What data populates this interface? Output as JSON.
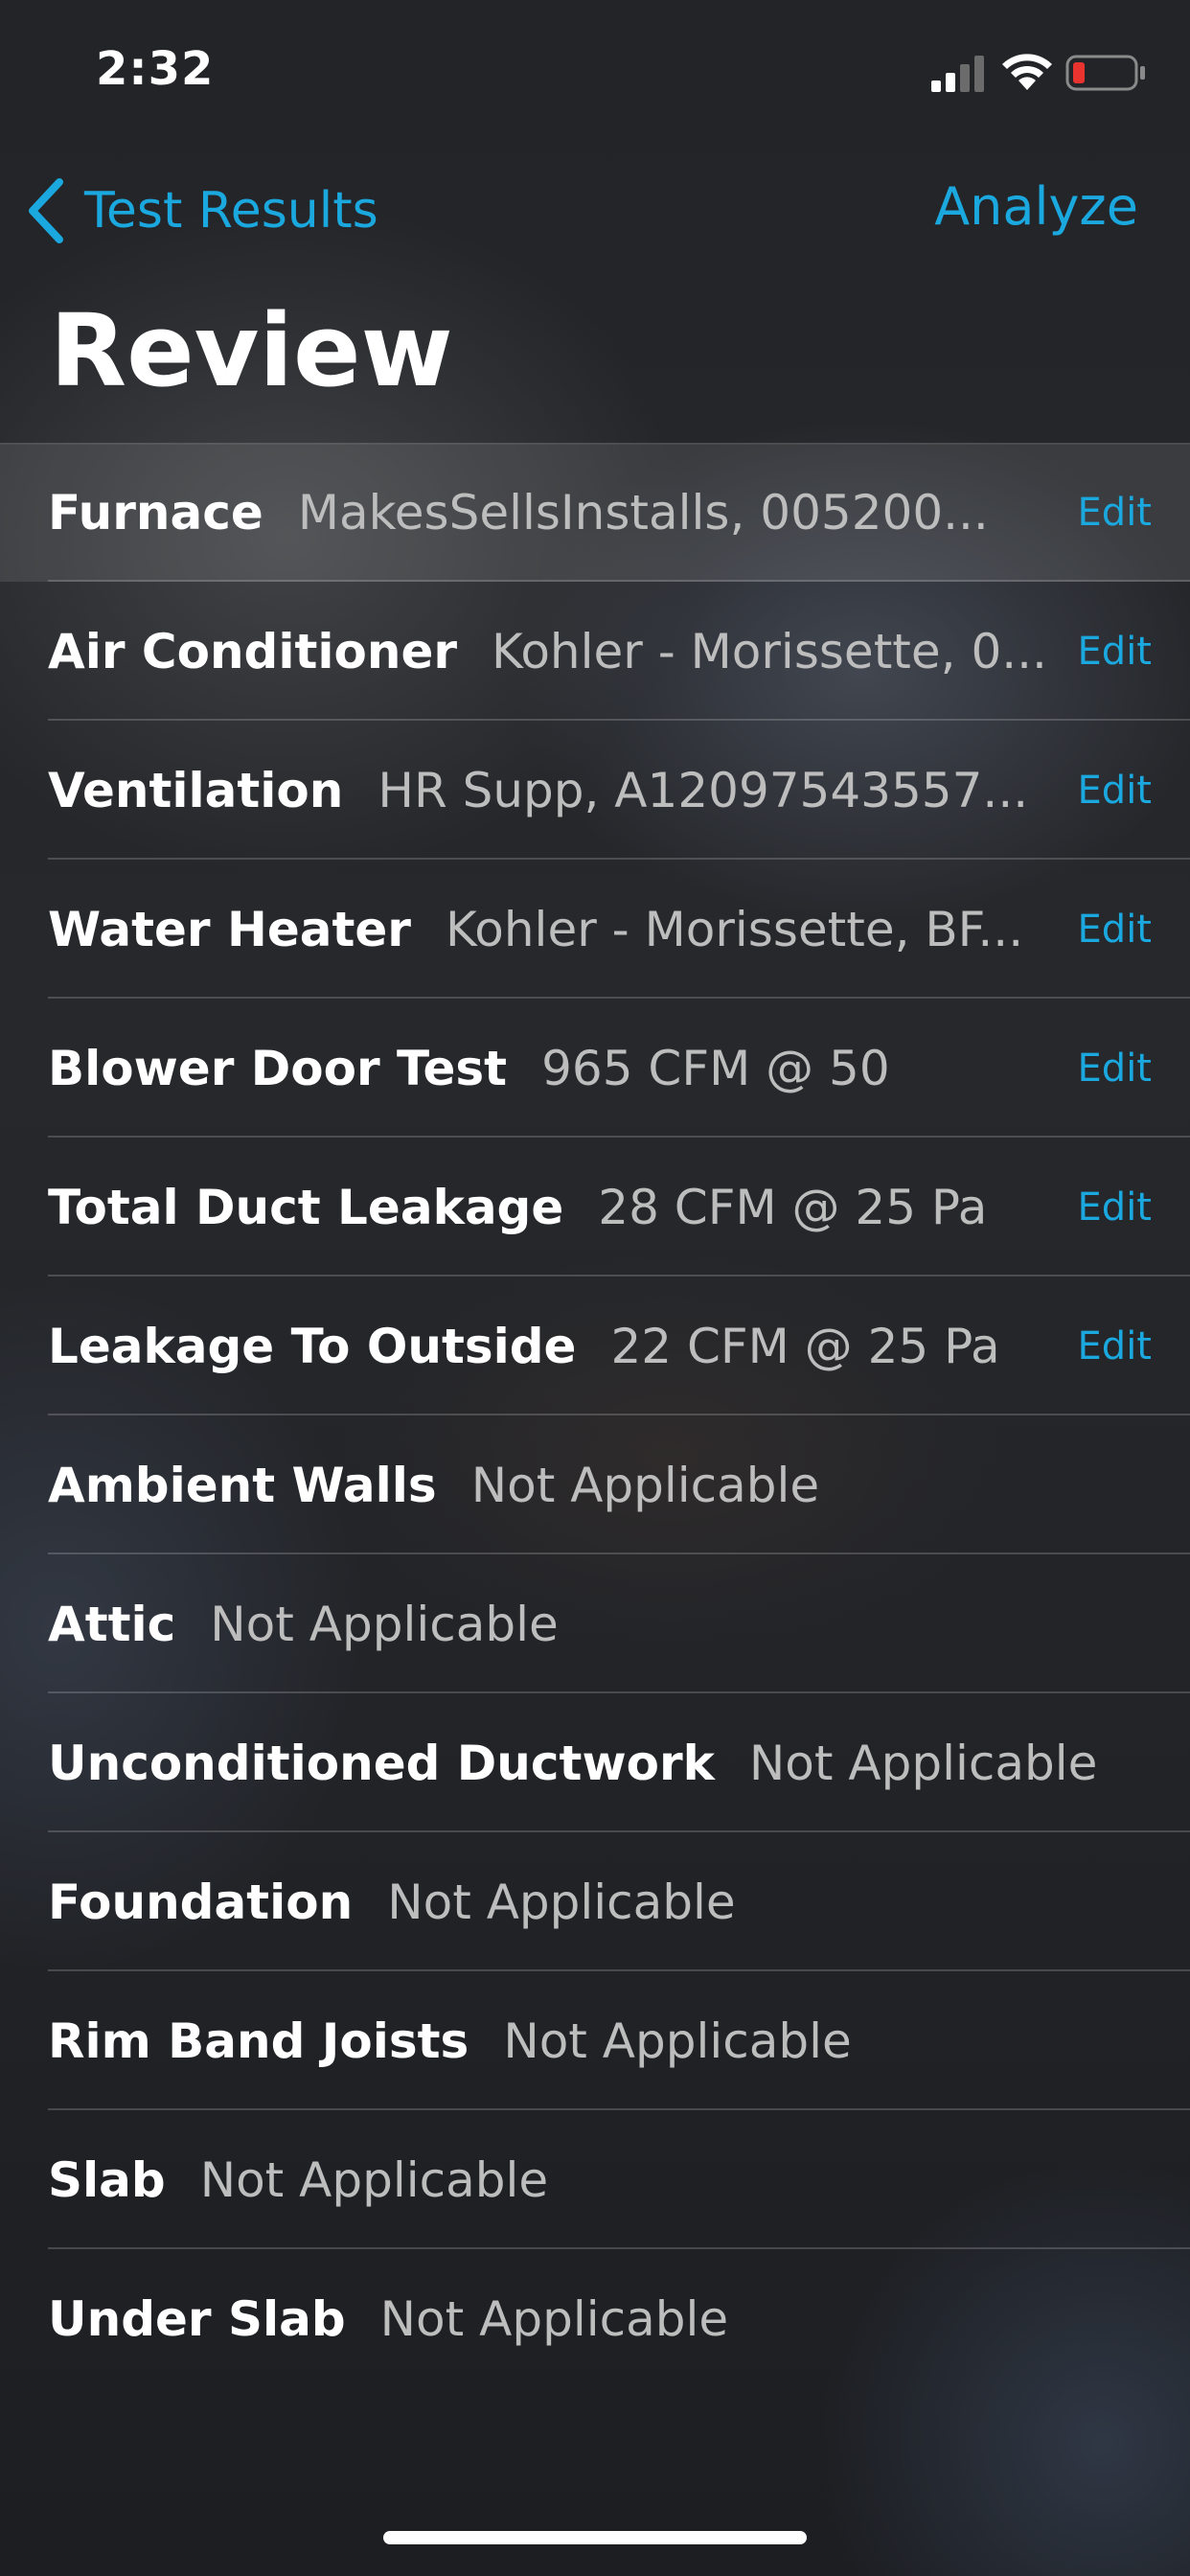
{
  "status_bar": {
    "time": "2:32",
    "icons": [
      "cellular-signal-icon",
      "wifi-icon",
      "battery-low-icon"
    ],
    "battery_color": "#e8332f"
  },
  "nav": {
    "back_label": "Test Results",
    "back_icon": "chevron-left-icon",
    "action_label": "Analyze",
    "accent_color": "#1aa8de"
  },
  "page_title": "Review",
  "rows": [
    {
      "title": "Furnace",
      "value": "MakesSellsInstalls, 005200...",
      "edit": "Edit"
    },
    {
      "title": "Air Conditioner",
      "value": "Kohler - Morissette, 0...",
      "edit": "Edit"
    },
    {
      "title": "Ventilation",
      "value": "HR Supp, A12097543557...",
      "edit": "Edit"
    },
    {
      "title": "Water Heater",
      "value": "Kohler - Morissette, BF...",
      "edit": "Edit"
    },
    {
      "title": "Blower Door Test",
      "value": "965 CFM @ 50",
      "edit": "Edit"
    },
    {
      "title": "Total Duct Leakage",
      "value": "28 CFM @ 25 Pa",
      "edit": "Edit"
    },
    {
      "title": "Leakage To Outside",
      "value": "22 CFM @ 25 Pa",
      "edit": "Edit"
    },
    {
      "title": "Ambient Walls",
      "value": "Not Applicable"
    },
    {
      "title": "Attic",
      "value": "Not Applicable"
    },
    {
      "title": "Unconditioned Ductwork",
      "value": "Not Applicable"
    },
    {
      "title": "Foundation",
      "value": "Not Applicable"
    },
    {
      "title": "Rim Band Joists",
      "value": "Not Applicable"
    },
    {
      "title": "Slab",
      "value": "Not Applicable"
    },
    {
      "title": "Under Slab",
      "value": "Not Applicable"
    }
  ]
}
